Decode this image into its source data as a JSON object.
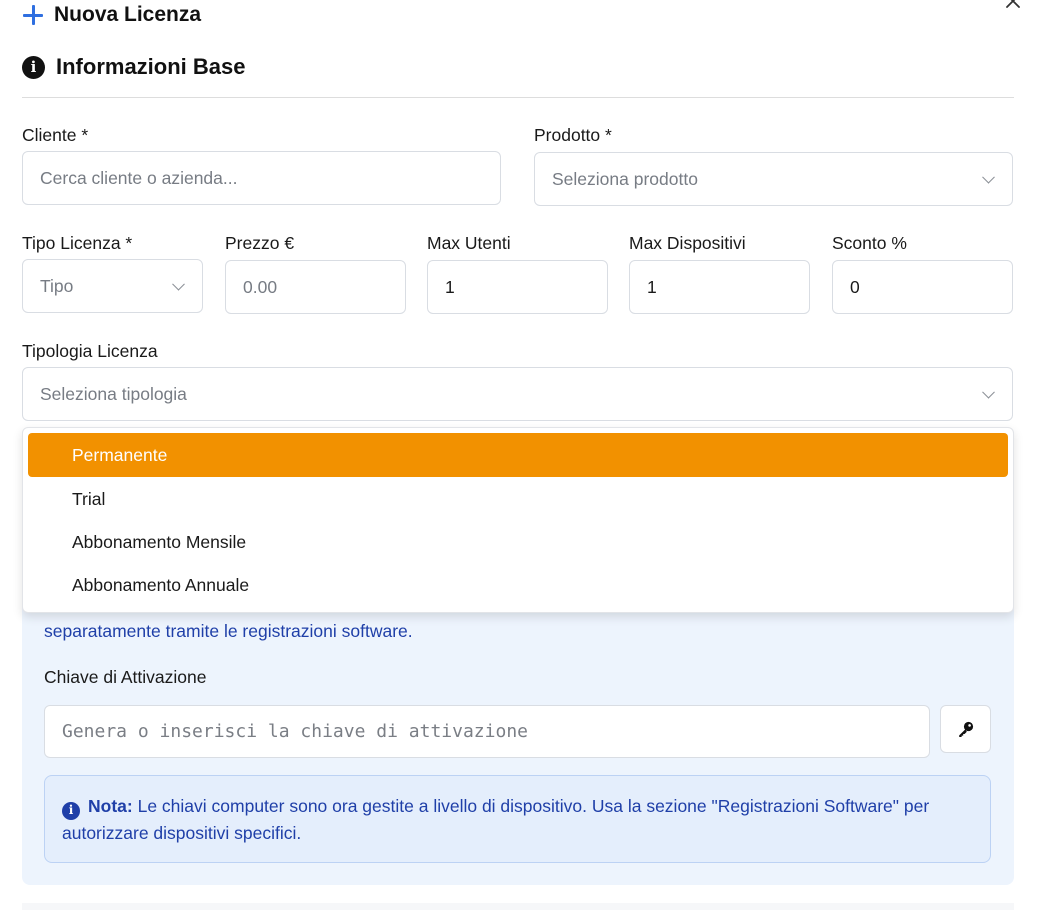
{
  "header": {
    "title": "Nuova Licenza"
  },
  "section": {
    "title": "Informazioni Base"
  },
  "fields": {
    "cliente": {
      "label": "Cliente *",
      "placeholder": "Cerca cliente o azienda..."
    },
    "prodotto": {
      "label": "Prodotto *",
      "placeholder": "Seleziona prodotto"
    },
    "tipo_licenza": {
      "label": "Tipo Licenza *",
      "placeholder": "Tipo"
    },
    "prezzo": {
      "label": "Prezzo €",
      "placeholder": "0.00"
    },
    "max_utenti": {
      "label": "Max Utenti",
      "value": "1"
    },
    "max_dispositivi": {
      "label": "Max Dispositivi",
      "value": "1"
    },
    "sconto": {
      "label": "Sconto %",
      "value": "0"
    },
    "tipologia": {
      "label": "Tipologia Licenza",
      "placeholder": "Seleziona tipologia"
    }
  },
  "dropdown": {
    "options": [
      "Permanente",
      "Trial",
      "Abbonamento Mensile",
      "Abbonamento Annuale"
    ],
    "highlighted": "Permanente"
  },
  "activation": {
    "partial_text": "separatamente tramite le registrazioni software.",
    "key_label": "Chiave di Attivazione",
    "key_placeholder": "Genera o inserisci la chiave di attivazione"
  },
  "note": {
    "bold": "Nota:",
    "text": "Le chiavi computer sono ora gestite a livello di dispositivo. Usa la sezione \"Registrazioni Software\" per autorizzare dispositivi specifici."
  },
  "icons": {
    "header": "plus-icon",
    "close": "close-icon",
    "section": "info-icon",
    "key_button": "key-icon",
    "note": "info-icon"
  },
  "colors": {
    "accent_blue": "#2f6fe0",
    "selected_option": "#f29100",
    "info_text": "#1f3fa8",
    "panel_bg": "#edf4fd"
  }
}
